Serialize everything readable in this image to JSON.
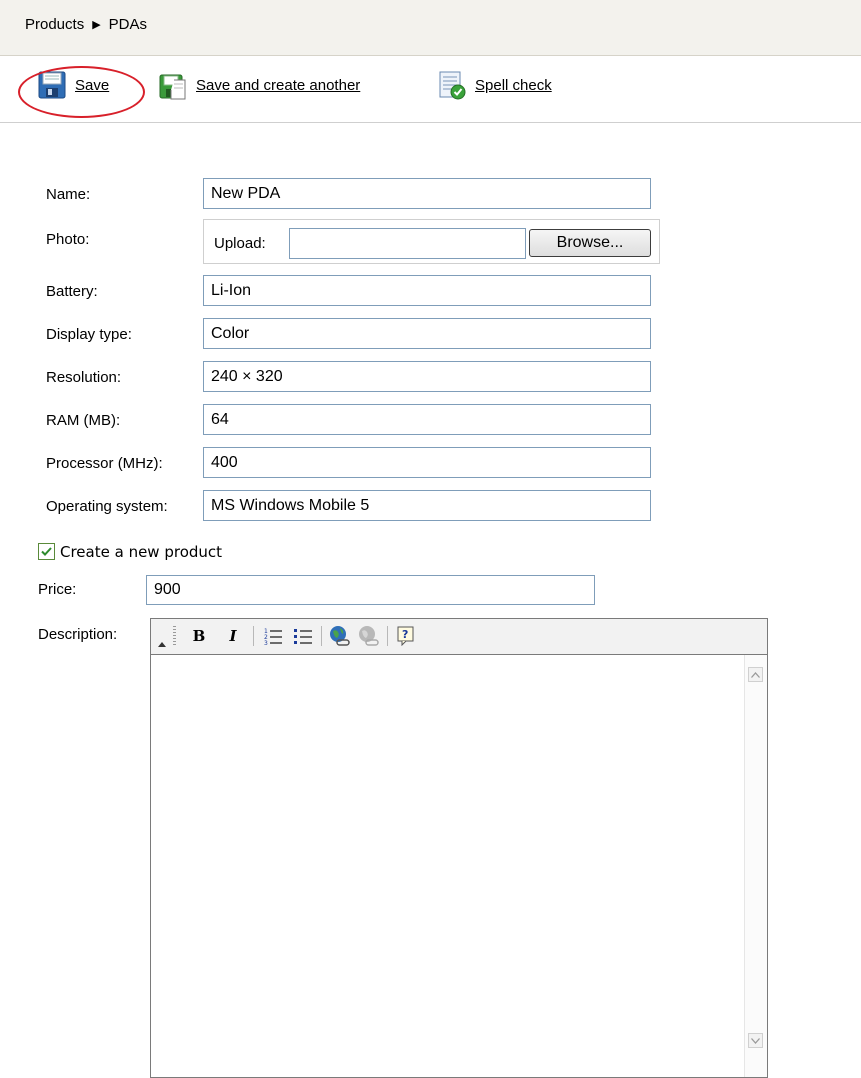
{
  "breadcrumb": {
    "parent": "Products",
    "separator": "▶",
    "current": "PDAs"
  },
  "toolbar": {
    "save_label": "Save",
    "save_and_create_label": "Save and create another",
    "spell_check_label": "Spell check"
  },
  "form": {
    "name": {
      "label": "Name:",
      "value": "New PDA"
    },
    "photo": {
      "label": "Photo:",
      "upload_label": "Upload:",
      "value": "",
      "browse_label": "Browse..."
    },
    "battery": {
      "label": "Battery:",
      "value": "Li-Ion"
    },
    "display_type": {
      "label": "Display type:",
      "value": "Color"
    },
    "resolution": {
      "label": "Resolution:",
      "value": "240 × 320"
    },
    "ram": {
      "label": "RAM (MB):",
      "value": "64"
    },
    "processor": {
      "label": "Processor (MHz):",
      "value": "400"
    },
    "os": {
      "label": "Operating system:",
      "value": "MS Windows Mobile 5"
    },
    "create_product": {
      "label": "Create a new product",
      "checked": true
    },
    "price": {
      "label": "Price:",
      "value": "900"
    },
    "description": {
      "label": "Description:",
      "value": ""
    }
  },
  "editor_toolbar": {
    "bold": "B",
    "italic": "I",
    "icons": [
      "bold-icon",
      "italic-icon",
      "numbered-list-icon",
      "bulleted-list-icon",
      "insert-link-icon",
      "remove-link-icon",
      "help-icon"
    ]
  },
  "colors": {
    "highlight_ring": "#d8202a",
    "input_border": "#7f9db9",
    "breadcrumb_bg": "#f3f2ed"
  }
}
